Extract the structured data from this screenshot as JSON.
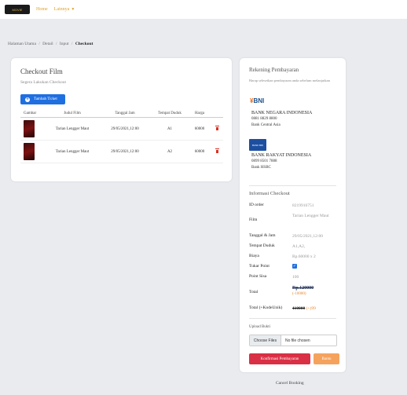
{
  "nav": {
    "logo_text": "MOVIE",
    "home_label": "Home",
    "more_label": "Lainnya",
    "caret": "▼"
  },
  "breadcrumb": {
    "items": [
      "Halaman Utama",
      "Detail",
      "Input"
    ],
    "current": "Checkout",
    "separator": "/"
  },
  "checkout": {
    "title": "Checkout Film",
    "subtitle": "Segera Lakukan Checkout",
    "add_button": "Tambah Ticket",
    "add_icon": "+",
    "columns": [
      "Gambar",
      "Judul Film",
      "Tanggal Jam",
      "Tempat Duduk",
      "Harga"
    ],
    "rows": [
      {
        "film": "Tarian Lengger Maut",
        "datetime": "29/05/2021,12:00",
        "seat": "A1",
        "price": "60000"
      },
      {
        "film": "Tarian Lengger Maut",
        "datetime": "29/05/2021,12:00",
        "seat": "A2",
        "price": "60000"
      }
    ]
  },
  "payment": {
    "title": "Rekening Pembayaran",
    "note": "Harap seleseikan pembayaran anda sebelum melanjutkan",
    "banks": [
      {
        "logo": "BNI",
        "name": "BANK NEGARA INDONESIA",
        "number": "0881 8829 8800",
        "branch": "Bank Central Asia"
      },
      {
        "logo": "BANK BRI",
        "name": "BANK RAKYAT INDONESIA",
        "number": "0899 8501 7888",
        "branch": "Bank HSBC"
      }
    ]
  },
  "info": {
    "title": "Informasi Checkout",
    "order_label": "ID order",
    "order_value": "8219916751",
    "film_label": "Film",
    "film_value": "Tarian Lengger Maut",
    "date_label": "Tanggal & Jam",
    "date_value": "29/05/2021,12:00",
    "seat_label": "Tempat Duduk",
    "seat_value": "A1,A2,",
    "cost_label": "Biaya",
    "cost_value": "Rp.60000 x 2",
    "point_label": "Tukar Point",
    "point_checked": "✓",
    "remain_label": "Point Sisa",
    "remain_value": "100",
    "total_label": "Total",
    "total_value": "Rp.120000",
    "total_discount": "(-10000)",
    "unique_label": "Total (+KodeUnik)",
    "unique_value": "110000",
    "unique_extra": "(+)99"
  },
  "upload": {
    "label": "Upload Bukti",
    "choose_button": "Choose Files",
    "no_file": "No file chosen",
    "confirm_button": "Konfirmasi Pembayaran",
    "help_button": "Bantu"
  },
  "cancel_link": "Cancel Booking",
  "colors": {
    "primary": "#1f6fe0",
    "danger": "#d93045",
    "warning": "#f5a25d",
    "nav_link": "#e0a22a"
  }
}
